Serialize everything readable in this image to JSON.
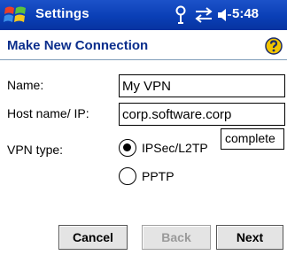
{
  "titlebar": {
    "app_title": "Settings",
    "time": "5:48",
    "icons": [
      "windows-start-icon",
      "antenna-icon",
      "connectivity-icon",
      "speaker-icon"
    ]
  },
  "header": {
    "page_title": "Make New Connection",
    "help_icon": "help-icon"
  },
  "form": {
    "name_label": "Name:",
    "name_value": "My VPN",
    "host_label": "Host name/ IP:",
    "host_value": "corp.software.corp",
    "autocomplete_suggestion": "complete",
    "vpn_type_label": "VPN type:",
    "vpn_options": [
      {
        "label": "IPSec/L2TP",
        "selected": true
      },
      {
        "label": "PPTP",
        "selected": false
      }
    ]
  },
  "buttons": {
    "cancel": "Cancel",
    "back": "Back",
    "next": "Next",
    "back_enabled": false
  },
  "colors": {
    "titlebar": "#0a3fb6",
    "page_title": "#0b2e8c",
    "help_icon": "#f2c400"
  }
}
